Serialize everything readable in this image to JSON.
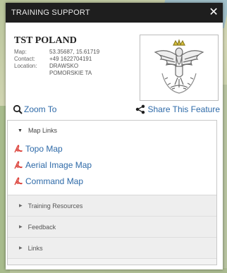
{
  "popup": {
    "title": "TRAINING SUPPORT",
    "close_glyph": "✕"
  },
  "feature": {
    "name": "TST POLAND",
    "fields": [
      {
        "label": "Map:",
        "value": "53.35687, 15.61719"
      },
      {
        "label": "Contact:",
        "value": "+49 1622704191"
      },
      {
        "label": "Location:",
        "value": "DRAWSKO POMORSKIE TA"
      }
    ],
    "image_icon": "polish-eagle-crest"
  },
  "actions": {
    "zoom_label": "Zoom To",
    "share_label": "Share This Feature"
  },
  "sections": {
    "map_links": {
      "label": "Map Links",
      "links": [
        "Topo Map",
        "Aerial Image Map",
        "Command Map"
      ]
    },
    "collapsed": [
      "Training Resources",
      "Feedback",
      "Links"
    ]
  },
  "colors": {
    "link": "#2e6aa8",
    "titlebar": "#1e1e1e",
    "pdf_icon": "#d9332b"
  }
}
